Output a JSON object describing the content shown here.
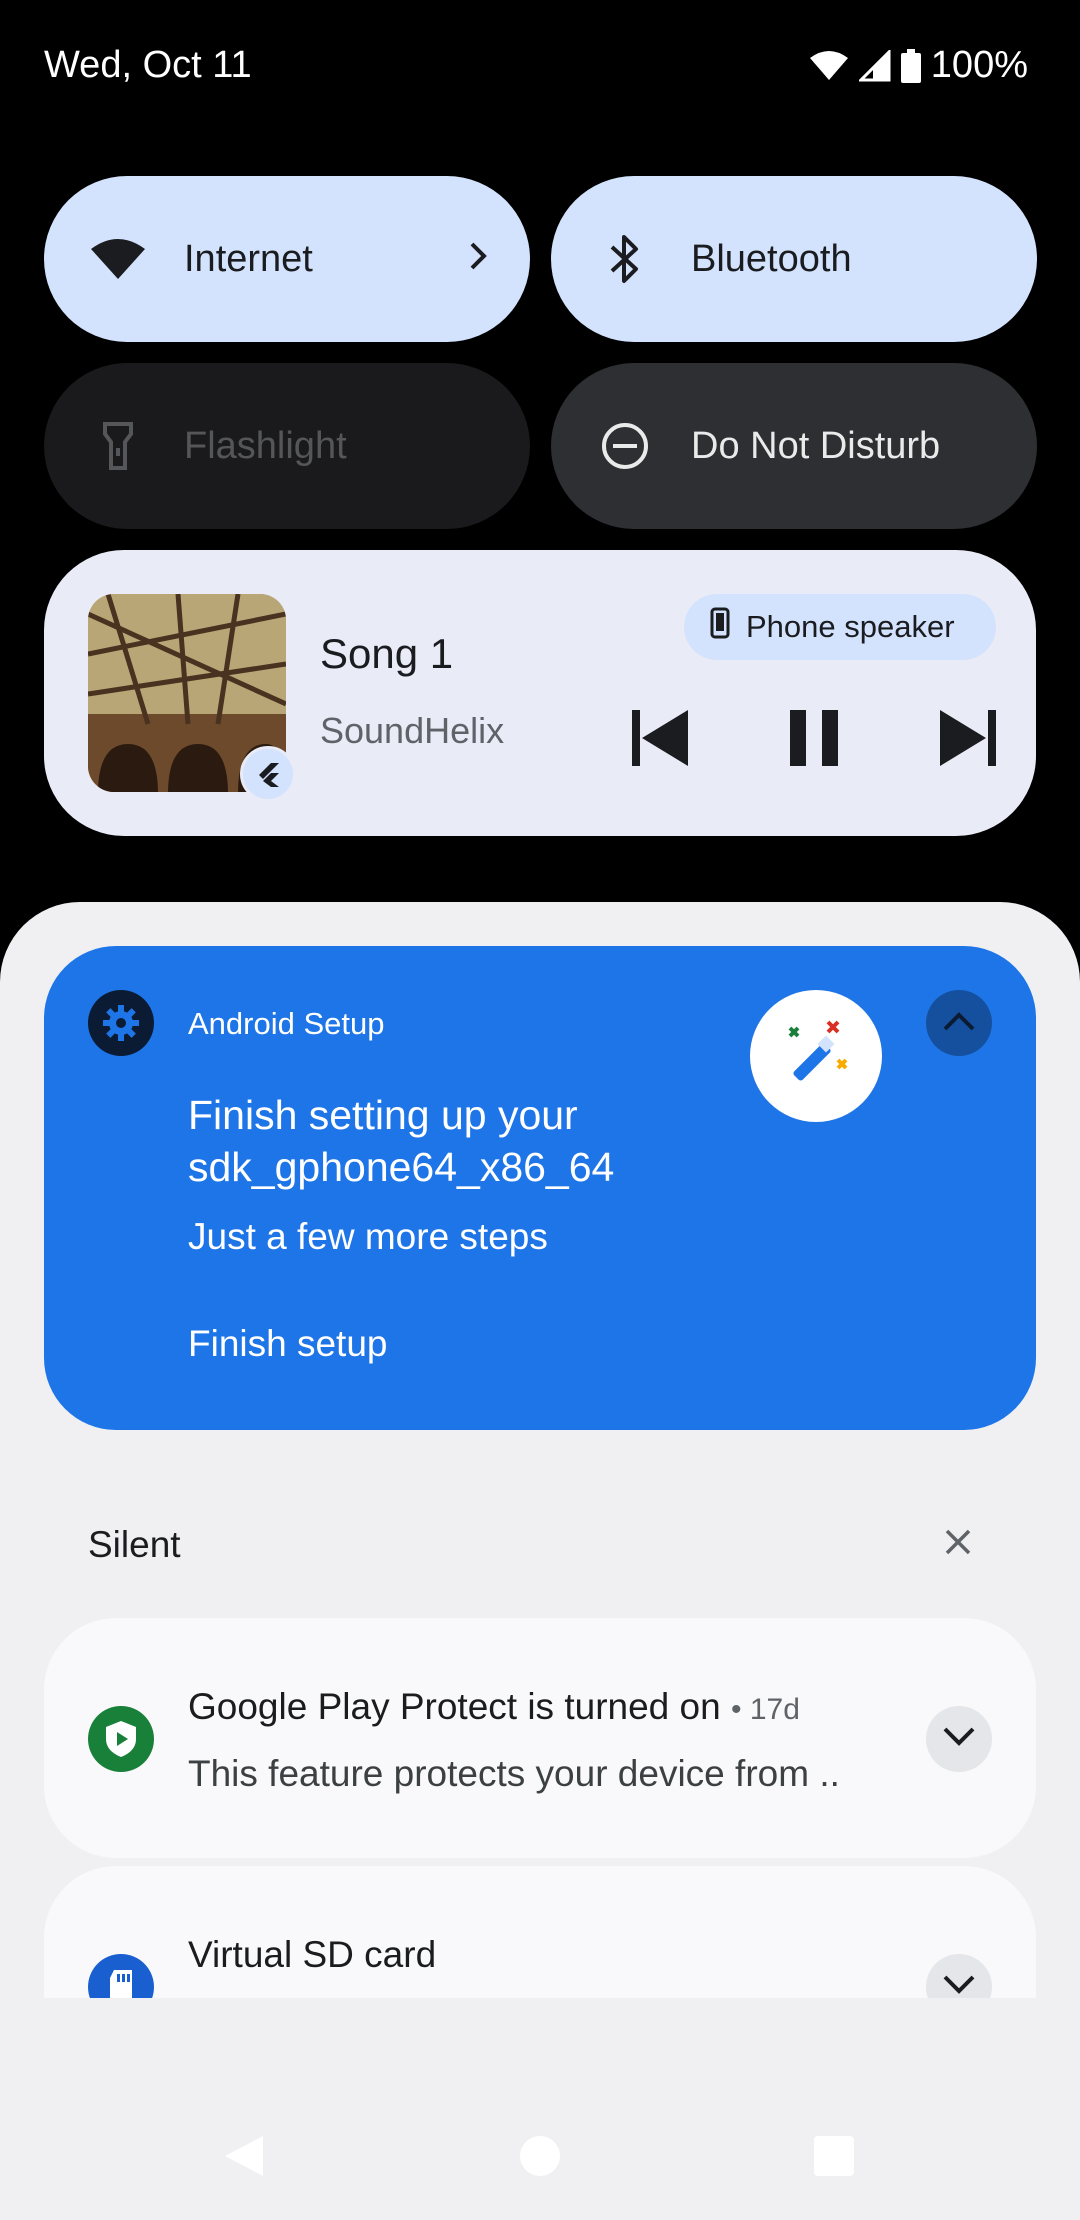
{
  "status_bar": {
    "date": "Wed, Oct 11",
    "battery": "100%",
    "icons": [
      "wifi-icon",
      "cell-signal-icon",
      "battery-icon"
    ]
  },
  "quick_settings": {
    "tiles": [
      {
        "label": "Internet",
        "icon": "wifi-icon",
        "state": "on",
        "has_chevron": true
      },
      {
        "label": "Bluetooth",
        "icon": "bluetooth-icon",
        "state": "on"
      },
      {
        "label": "Flashlight",
        "icon": "flashlight-icon",
        "state": "unavailable"
      },
      {
        "label": "Do Not Disturb",
        "icon": "do-not-disturb-icon",
        "state": "off"
      }
    ]
  },
  "media": {
    "title": "Song 1",
    "artist": "SoundHelix",
    "output_device": "Phone speaker",
    "controls": [
      "skip-previous-icon",
      "pause-icon",
      "skip-next-icon"
    ]
  },
  "notifications": {
    "setup": {
      "app": "Android Setup",
      "title": "Finish setting up your sdk_gphone64_x86_64",
      "text": "Just a few more steps",
      "action": "Finish setup",
      "color": "#1e75e8"
    },
    "silent_section": {
      "label": "Silent",
      "items": [
        {
          "title": "Google Play Protect is turned on",
          "time": "• 17d",
          "text": "This feature protects your device from ..",
          "icon": "shield-icon",
          "icon_color": "#188038"
        },
        {
          "title": "Virtual SD card",
          "icon": "sd-card-icon",
          "icon_color": "#1a5fd0"
        }
      ]
    }
  },
  "navigation": {
    "buttons": [
      "back-icon",
      "home-icon",
      "recents-icon"
    ]
  }
}
